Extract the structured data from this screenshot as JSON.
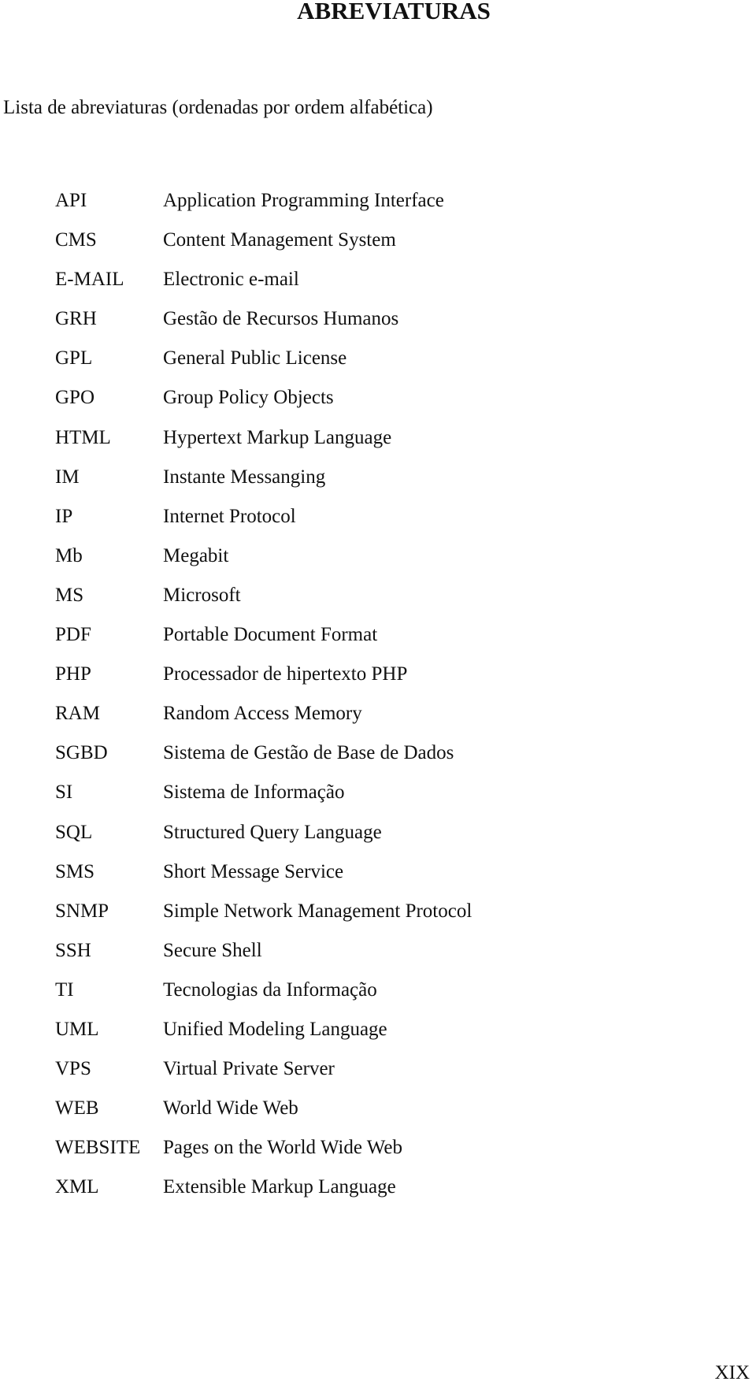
{
  "page": {
    "title": "ABREVIATURAS",
    "intro": "Lista de abreviaturas (ordenadas por ordem alfabética)",
    "page_number": "XIX"
  },
  "abbreviations": [
    {
      "code": "API",
      "meaning": "Application Programming Interface"
    },
    {
      "code": "CMS",
      "meaning": "Content Management System"
    },
    {
      "code": "E-MAIL",
      "meaning": "Electronic e-mail"
    },
    {
      "code": "GRH",
      "meaning": "Gestão de Recursos Humanos"
    },
    {
      "code": "GPL",
      "meaning": "General Public License"
    },
    {
      "code": "GPO",
      "meaning": "Group Policy Objects"
    },
    {
      "code": "HTML",
      "meaning": "Hypertext Markup Language"
    },
    {
      "code": "IM",
      "meaning": "Instante Messanging"
    },
    {
      "code": "IP",
      "meaning": "Internet Protocol"
    },
    {
      "code": "Mb",
      "meaning": "Megabit"
    },
    {
      "code": "MS",
      "meaning": "Microsoft"
    },
    {
      "code": "PDF",
      "meaning": "Portable Document Format"
    },
    {
      "code": "PHP",
      "meaning": "Processador de hipertexto PHP"
    },
    {
      "code": "RAM",
      "meaning": "Random Access Memory"
    },
    {
      "code": "SGBD",
      "meaning": "Sistema de Gestão de Base de Dados"
    },
    {
      "code": "SI",
      "meaning": "Sistema de Informação"
    },
    {
      "code": "SQL",
      "meaning": "Structured Query Language"
    },
    {
      "code": "SMS",
      "meaning": "Short Message Service"
    },
    {
      "code": "SNMP",
      "meaning": "Simple Network Management Protocol"
    },
    {
      "code": "SSH",
      "meaning": "Secure Shell"
    },
    {
      "code": "TI",
      "meaning": "Tecnologias da Informação"
    },
    {
      "code": "UML",
      "meaning": "Unified Modeling Language"
    },
    {
      "code": "VPS",
      "meaning": "Virtual Private Server"
    },
    {
      "code": "WEB",
      "meaning": "World Wide Web"
    },
    {
      "code": "WEBSITE",
      "meaning": "Pages on the World Wide Web"
    },
    {
      "code": "XML",
      "meaning": "Extensible Markup Language"
    }
  ]
}
